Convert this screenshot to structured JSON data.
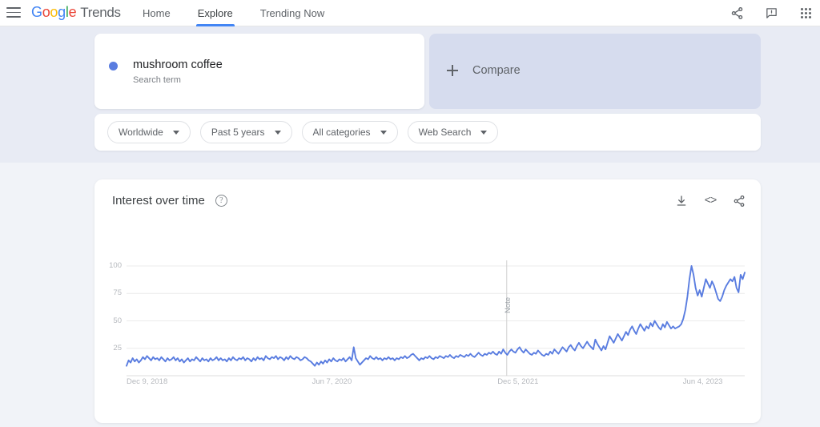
{
  "header": {
    "menu_icon": "hamburger-menu-icon",
    "brand": {
      "google": [
        "G",
        "o",
        "o",
        "g",
        "l",
        "e"
      ],
      "product": "Trends"
    },
    "nav": [
      {
        "label": "Home",
        "active": false
      },
      {
        "label": "Explore",
        "active": true
      },
      {
        "label": "Trending Now",
        "active": false
      }
    ],
    "icons": [
      {
        "name": "share-icon"
      },
      {
        "name": "feedback-icon"
      },
      {
        "name": "google-apps-icon"
      }
    ]
  },
  "search_term": {
    "title": "mushroom coffee",
    "subtitle": "Search term"
  },
  "compare": {
    "label": "Compare",
    "icon": "plus-icon",
    "background": "#d6dcee"
  },
  "filters": [
    {
      "label": "Worldwide"
    },
    {
      "label": "Past 5 years"
    },
    {
      "label": "All categories"
    },
    {
      "label": "Web Search"
    }
  ],
  "chart_card": {
    "title": "Interest over time",
    "help_icon": "?",
    "tools": [
      {
        "name": "download-icon"
      },
      {
        "name": "embed-icon",
        "glyph": "<>"
      },
      {
        "name": "share-icon"
      }
    ]
  },
  "chart_data": {
    "type": "line",
    "title": "Interest over time",
    "xlabel": "",
    "ylabel": "",
    "ylim": [
      0,
      100
    ],
    "yticks": [
      25,
      50,
      75,
      100
    ],
    "grid": true,
    "legend_position": "none",
    "line_color": "#5a7de0",
    "xtick_labels": [
      "Dec 9, 2018",
      "Jun 7, 2020",
      "Dec 5, 2021",
      "Jun 4, 2023"
    ],
    "xtick_positions": [
      0,
      0.3,
      0.6,
      0.9
    ],
    "annotations": [
      {
        "label": "Note",
        "x_fraction": 0.615
      }
    ],
    "series": [
      {
        "name": "mushroom coffee",
        "values": [
          9,
          14,
          12,
          16,
          13,
          15,
          12,
          14,
          17,
          15,
          18,
          16,
          14,
          17,
          15,
          16,
          14,
          17,
          15,
          13,
          16,
          14,
          15,
          17,
          14,
          16,
          13,
          15,
          12,
          14,
          16,
          13,
          15,
          14,
          17,
          15,
          13,
          16,
          14,
          15,
          13,
          16,
          14,
          15,
          17,
          14,
          16,
          14,
          15,
          13,
          16,
          14,
          17,
          15,
          14,
          16,
          15,
          17,
          14,
          16,
          15,
          13,
          16,
          14,
          17,
          15,
          16,
          14,
          18,
          16,
          15,
          17,
          16,
          18,
          15,
          17,
          16,
          14,
          17,
          15,
          18,
          16,
          15,
          17,
          16,
          14,
          15,
          17,
          16,
          14,
          13,
          11,
          9,
          12,
          10,
          13,
          11,
          14,
          12,
          15,
          13,
          16,
          14,
          13,
          15,
          14,
          16,
          13,
          15,
          17,
          14,
          26,
          16,
          13,
          10,
          12,
          14,
          16,
          15,
          18,
          16,
          15,
          17,
          15,
          16,
          14,
          16,
          15,
          17,
          15,
          16,
          14,
          16,
          15,
          17,
          16,
          18,
          16,
          17,
          19,
          20,
          18,
          16,
          14,
          16,
          15,
          17,
          16,
          18,
          16,
          15,
          17,
          16,
          18,
          17,
          16,
          18,
          17,
          19,
          17,
          16,
          18,
          17,
          19,
          18,
          17,
          19,
          18,
          20,
          18,
          17,
          19,
          21,
          19,
          18,
          20,
          19,
          21,
          20,
          22,
          20,
          19,
          22,
          20,
          24,
          21,
          19,
          22,
          24,
          22,
          21,
          24,
          26,
          23,
          21,
          24,
          22,
          20,
          19,
          21,
          20,
          23,
          21,
          19,
          18,
          20,
          19,
          22,
          20,
          24,
          22,
          20,
          23,
          26,
          24,
          22,
          26,
          28,
          25,
          23,
          27,
          30,
          27,
          25,
          28,
          31,
          28,
          26,
          24,
          33,
          29,
          26,
          23,
          27,
          24,
          30,
          36,
          33,
          30,
          34,
          38,
          35,
          32,
          36,
          40,
          37,
          42,
          45,
          41,
          38,
          43,
          47,
          44,
          41,
          45,
          43,
          48,
          45,
          50,
          47,
          44,
          42,
          47,
          44,
          49,
          46,
          43,
          45,
          43,
          44,
          45,
          47,
          52,
          60,
          72,
          88,
          100,
          92,
          80,
          73,
          78,
          72,
          80,
          88,
          84,
          80,
          86,
          82,
          76,
          70,
          68,
          72,
          78,
          82,
          85,
          88,
          86,
          90,
          80,
          76,
          92,
          88,
          94
        ]
      }
    ]
  },
  "colors": {
    "band_top": "#e8ebf4",
    "page_bg": "#f1f3f8",
    "accent_blue": "#4285f4",
    "line_blue": "#5a7de0"
  }
}
